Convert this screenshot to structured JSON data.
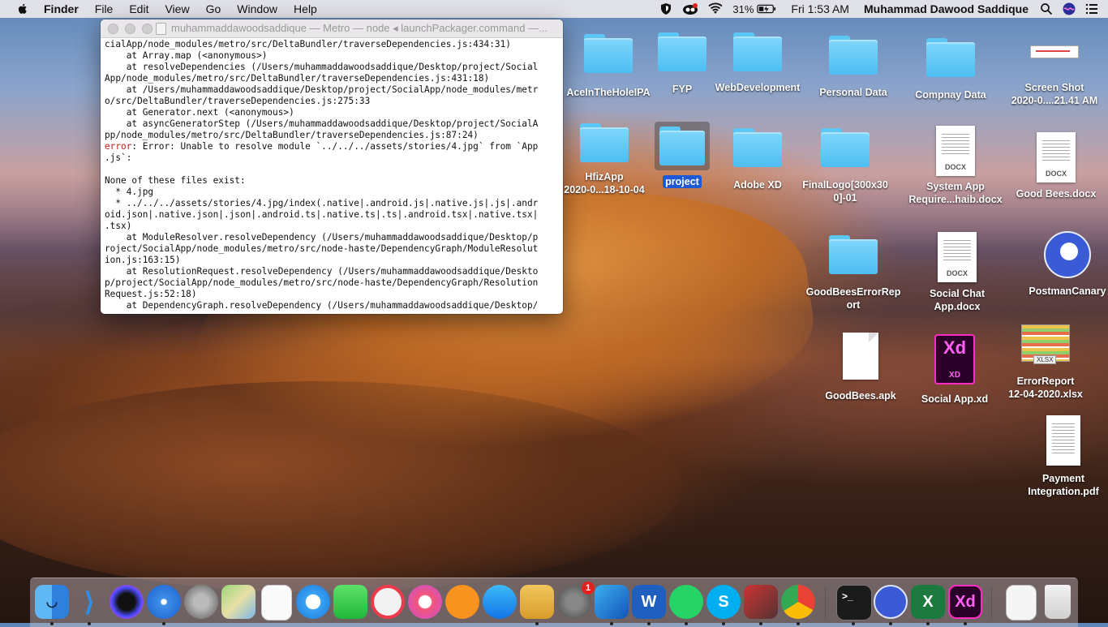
{
  "menubar": {
    "app_name": "Finder",
    "menus": [
      "File",
      "Edit",
      "View",
      "Go",
      "Window",
      "Help"
    ],
    "battery": "31%",
    "clock": "Fri 1:53 AM",
    "user": "Muhammad Dawood Saddique"
  },
  "terminal": {
    "title": "muhammaddawoodsaddique — Metro — node ◂ launchPackager.command —...",
    "lines_before_error": [
      "cialApp/node_modules/metro/src/DeltaBundler/traverseDependencies.js:434:31)",
      "    at Array.map (<anonymous>)",
      "    at resolveDependencies (/Users/muhammaddawoodsaddique/Desktop/project/Social",
      "App/node_modules/metro/src/DeltaBundler/traverseDependencies.js:431:18)",
      "    at /Users/muhammaddawoodsaddique/Desktop/project/SocialApp/node_modules/metr",
      "o/src/DeltaBundler/traverseDependencies.js:275:33",
      "    at Generator.next (<anonymous>)",
      "    at asyncGeneratorStep (/Users/muhammaddawoodsaddique/Desktop/project/SocialA",
      "pp/node_modules/metro/src/DeltaBundler/traverseDependencies.js:87:24)"
    ],
    "error_keyword": "error",
    "error_line_1": ": Error: Unable to resolve module `../../../assets/stories/4.jpg` from `App",
    "error_line_2": ".js`:",
    "lines_after_error": [
      "",
      "None of these files exist:",
      "  * 4.jpg",
      "  * ../../../assets/stories/4.jpg/index(.native|.android.js|.native.js|.js|.andr",
      "oid.json|.native.json|.json|.android.ts|.native.ts|.ts|.android.tsx|.native.tsx|",
      ".tsx)",
      "    at ModuleResolver.resolveDependency (/Users/muhammaddawoodsaddique/Desktop/p",
      "roject/SocialApp/node_modules/metro/src/node-haste/DependencyGraph/ModuleResolut",
      "ion.js:163:15)",
      "    at ResolutionRequest.resolveDependency (/Users/muhammaddawoodsaddique/Deskto",
      "p/project/SocialApp/node_modules/metro/src/node-haste/DependencyGraph/Resolution",
      "Request.js:52:18)",
      "    at DependencyGraph.resolveDependency (/Users/muhammaddawoodsaddique/Desktop/"
    ]
  },
  "desktop": {
    "aceinthehole": "AceInTheHoleIPA",
    "fyp": "FYP",
    "webdev": "WebDevelopment",
    "personal": "Personal Data",
    "company": "Compnay Data",
    "screenshot": "Screen Shot\n2020-0....21.41 AM",
    "hfizapp": "HfizApp\n2020-0...18-10-04",
    "project": "project",
    "adobexd": "Adobe XD",
    "finallogo": "FinalLogo[300x30\n0]-01",
    "sysreq": "System App\nRequire...haib.docx",
    "goodbeesdocx": "Good Bees.docx",
    "goodbeeserror": "GoodBeesErrorRep\nort",
    "socialchat": "Social Chat\nApp.docx",
    "postman": "PostmanCanary",
    "goodbeesapk": "GoodBees.apk",
    "socialxd": "Social App.xd",
    "errorreport": "ErrorReport\n12-04-2020.xlsx",
    "payment": "Payment\nIntegration.pdf",
    "docx_tag": "DOCX",
    "xlsx_tag": "XLSX",
    "xd_big": "Xd",
    "xd_small": "XD"
  },
  "dock": {
    "appstore_badge": "1",
    "vscode_glyph": "⟩",
    "word_glyph": "W",
    "excel_glyph": "X",
    "xd_glyph": "Xd",
    "terminal_glyph": ">_",
    "skype_glyph": "S"
  }
}
